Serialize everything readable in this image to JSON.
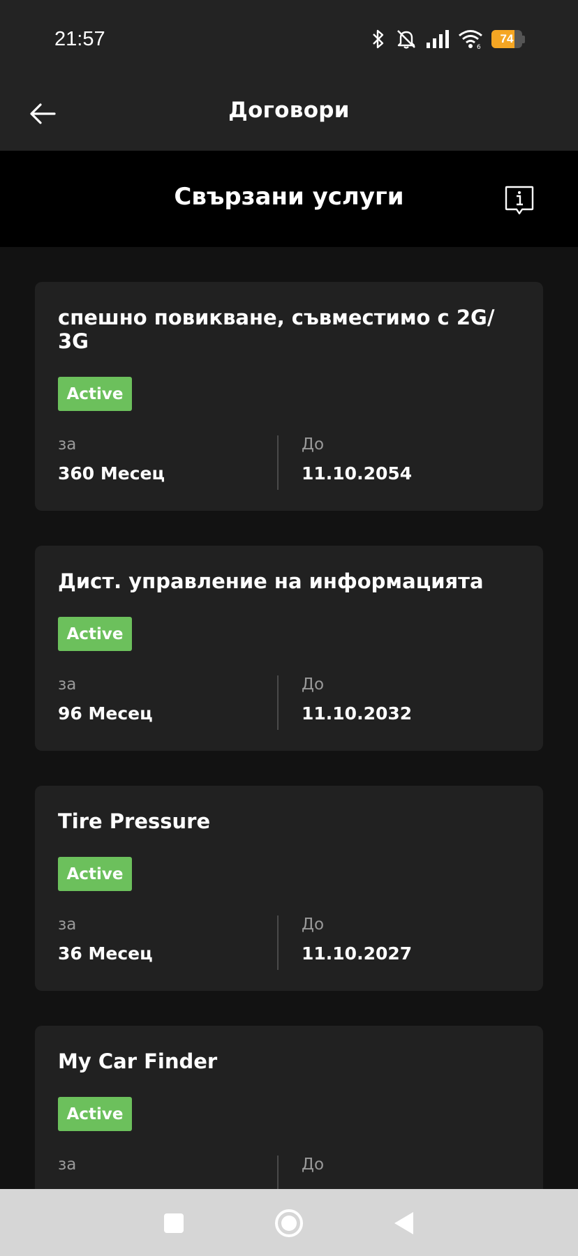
{
  "status_bar": {
    "time": "21:57",
    "battery_level": "74",
    "icons": [
      "bluetooth-icon",
      "mute-icon",
      "signal-icon",
      "wifi-icon",
      "battery-icon"
    ]
  },
  "app_bar": {
    "title": "Договори",
    "back_icon": "arrow-left-icon"
  },
  "section": {
    "title": "Свързани услуги",
    "info_icon": "info-icon"
  },
  "cards": [
    {
      "title": "спешно повикване, съвместимо с 2G/ 3G",
      "status": "Active",
      "duration_label": "за",
      "duration_value": "360 Месец",
      "until_label": "До",
      "until_value": "11.10.2054"
    },
    {
      "title": "Дист. управление на информацията",
      "status": "Active",
      "duration_label": "за",
      "duration_value": "96 Месец",
      "until_label": "До",
      "until_value": "11.10.2032"
    },
    {
      "title": "Tire Pressure",
      "status": "Active",
      "duration_label": "за",
      "duration_value": "36 Месец",
      "until_label": "До",
      "until_value": "11.10.2027"
    },
    {
      "title": "My Car Finder",
      "status": "Active",
      "duration_label": "за",
      "until_label": "До"
    }
  ],
  "colors": {
    "active_badge": "#6cc05c",
    "card_bg": "#212121",
    "header_bg": "#232323",
    "battery": "#f5a623"
  },
  "nav_bar": {
    "buttons": [
      "recents-icon",
      "home-icon",
      "back-triangle-icon"
    ]
  }
}
